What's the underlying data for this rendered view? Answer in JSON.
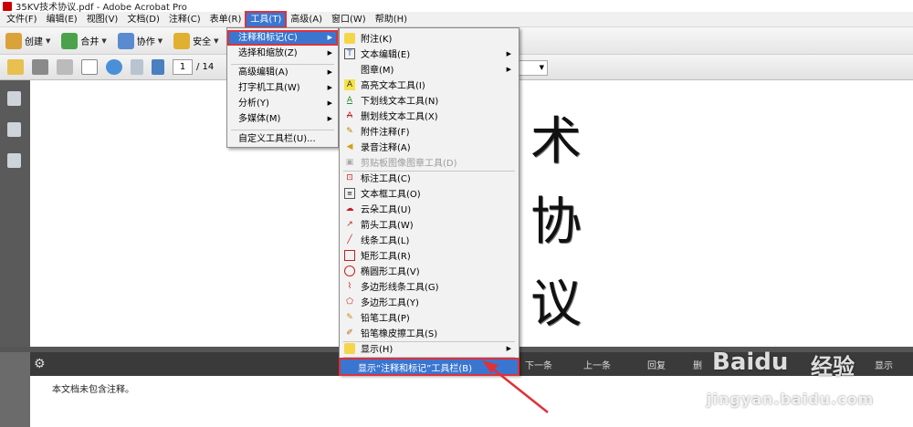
{
  "window": {
    "title": "35KV技术协议.pdf - Adobe Acrobat Pro"
  },
  "menubar": {
    "items": [
      {
        "label": "文件(F)"
      },
      {
        "label": "编辑(E)"
      },
      {
        "label": "视图(V)"
      },
      {
        "label": "文档(D)"
      },
      {
        "label": "注释(C)"
      },
      {
        "label": "表单(R)"
      },
      {
        "label": "工具(T)",
        "active": true
      },
      {
        "label": "高级(A)"
      },
      {
        "label": "窗口(W)"
      },
      {
        "label": "帮助(H)"
      }
    ]
  },
  "toolbar1": {
    "create": "创建",
    "combine": "合并",
    "collaborate": "协作",
    "secure": "安全"
  },
  "toolbar2": {
    "page_current": "1",
    "page_total": "/ 14"
  },
  "document": {
    "chars": [
      "术",
      "协",
      "议"
    ]
  },
  "comments": {
    "next": "下一条",
    "prev": "上一条",
    "reply": "回复",
    "delete": "删",
    "show": "显示",
    "empty_note": "本文档未包含注释。"
  },
  "tools_menu": {
    "items": [
      {
        "label": "注释和标记(C)",
        "submenu": true,
        "highlighted": true
      },
      {
        "label": "选择和缩放(Z)",
        "submenu": true
      },
      {
        "label": "高级编辑(A)",
        "submenu": true
      },
      {
        "label": "打字机工具(W)",
        "submenu": true
      },
      {
        "label": "分析(Y)",
        "submenu": true
      },
      {
        "label": "多媒体(M)",
        "submenu": true
      },
      {
        "label": "自定义工具栏(U)..."
      }
    ]
  },
  "markup_submenu": {
    "items": [
      {
        "label": "附注(K)",
        "icon": "note-icon"
      },
      {
        "label": "文本编辑(E)",
        "icon": "text-edit-icon",
        "submenu": true
      },
      {
        "label": "图章(M)",
        "icon": "stamp-icon",
        "submenu": true
      },
      {
        "label": "高亮文本工具(I)",
        "icon": "highlight-icon"
      },
      {
        "label": "下划线文本工具(N)",
        "icon": "underline-icon"
      },
      {
        "label": "删划线文本工具(X)",
        "icon": "strikethrough-icon"
      },
      {
        "label": "附件注释(F)",
        "icon": "paperclip-icon"
      },
      {
        "label": "录音注释(A)",
        "icon": "speaker-icon"
      },
      {
        "label": "剪贴板图像图章工具(D)",
        "icon": "clipboard-stamp-icon",
        "disabled": true
      },
      {
        "label": "标注工具(C)",
        "icon": "callout-icon"
      },
      {
        "label": "文本框工具(O)",
        "icon": "textbox-icon"
      },
      {
        "label": "云朵工具(U)",
        "icon": "cloud-icon"
      },
      {
        "label": "箭头工具(W)",
        "icon": "arrow-icon"
      },
      {
        "label": "线条工具(L)",
        "icon": "line-icon"
      },
      {
        "label": "矩形工具(R)",
        "icon": "rectangle-icon"
      },
      {
        "label": "椭圆形工具(V)",
        "icon": "ellipse-icon"
      },
      {
        "label": "多边形线条工具(G)",
        "icon": "polyline-icon"
      },
      {
        "label": "多边形工具(Y)",
        "icon": "polygon-icon"
      },
      {
        "label": "铅笔工具(P)",
        "icon": "pencil-icon"
      },
      {
        "label": "铅笔橡皮擦工具(S)",
        "icon": "pencil-eraser-icon"
      },
      {
        "label": "显示(H)",
        "icon": "show-icon",
        "submenu": true
      },
      {
        "label": "显示“注释和标记”工具栏(B)",
        "highlighted": true
      }
    ]
  },
  "watermark": {
    "brand": "Baidu",
    "jy": "经验",
    "url": "jingyan.baidu.com"
  },
  "colors": {
    "accent": "#3a76d0",
    "annotation_red": "#e0303a"
  }
}
